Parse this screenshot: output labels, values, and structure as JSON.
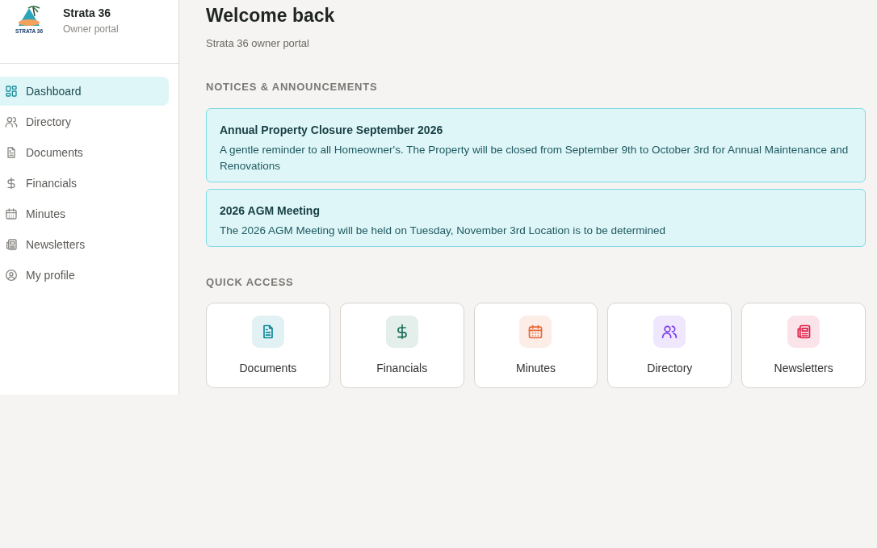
{
  "brand": {
    "logo_text": "STRATA 36",
    "name": "Strata 36",
    "subtitle": "Owner portal"
  },
  "nav": [
    {
      "label": "Dashboard",
      "kind": "grid",
      "selected": true
    },
    {
      "label": "Directory",
      "kind": "people",
      "selected": false
    },
    {
      "label": "Documents",
      "kind": "document",
      "selected": false
    },
    {
      "label": "Financials",
      "kind": "dollar",
      "selected": false
    },
    {
      "label": "Minutes",
      "kind": "calendar",
      "selected": false
    },
    {
      "label": "Newsletters",
      "kind": "newspaper",
      "selected": false
    },
    {
      "label": "My profile",
      "kind": "person",
      "selected": false
    }
  ],
  "header": {
    "title": "Welcome back",
    "subtitle": "Strata 36 owner portal"
  },
  "notices": {
    "heading": "NOTICES & ANNOUNCEMENTS",
    "items": [
      {
        "title": "Annual Property Closure September 2026",
        "body": "A gentle reminder to all Homeowner's. The Property will be closed from September 9th to October 3rd for Annual Maintenance and Renovations"
      },
      {
        "title": "2026 AGM Meeting",
        "body": "The 2026 AGM Meeting will be held on Tuesday, November 3rd Location is to be determined"
      }
    ]
  },
  "quick_access": {
    "heading": "QUICK ACCESS",
    "items": [
      {
        "label": "Documents",
        "kind": "document",
        "color": "#0e8a9a"
      },
      {
        "label": "Financials",
        "kind": "dollar",
        "color": "#1f6f5c"
      },
      {
        "label": "Minutes",
        "kind": "calendar",
        "color": "#ea6a3a"
      },
      {
        "label": "Directory",
        "kind": "people",
        "color": "#7c3aed"
      },
      {
        "label": "Newsletters",
        "kind": "newspaper",
        "color": "#e11d48"
      }
    ]
  }
}
